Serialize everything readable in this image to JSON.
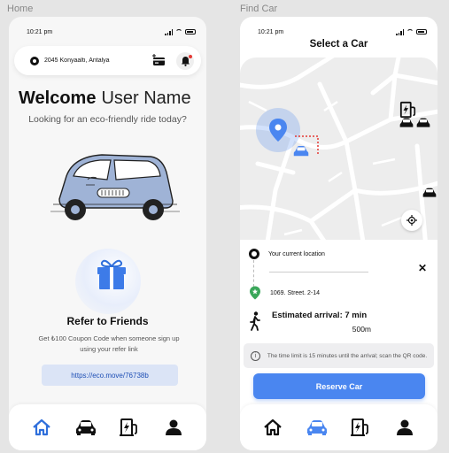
{
  "frames": {
    "home_label": "Home",
    "find_label": "Find Car"
  },
  "status": {
    "time": "10:21 pm"
  },
  "home": {
    "address": "2045 Konyaaltı, Antalya",
    "welcome_bold": "Welcome",
    "welcome_name": "User Name",
    "subtitle": "Looking for an eco-friendly ride today?",
    "refer_title": "Refer to Friends",
    "refer_subtitle": "Get ₺100 Coupon Code when someone sign up using your refer link",
    "refer_link": "https://eco.move/76738b"
  },
  "find": {
    "title": "Select a Car",
    "current_location": "Your current location",
    "destination": "1069. Street. 2-14",
    "eta": "Estimated arrival: 7 min",
    "distance": "500m",
    "info": "The time limit is 15 minutes until the arrival; scan the QR code.",
    "reserve_label": "Reserve Car"
  },
  "tabs": [
    "home-icon",
    "car-icon",
    "charging-station-icon",
    "user-icon"
  ],
  "colors": {
    "accent": "#4a86f0",
    "home_active_tab": "#2f6fdb",
    "car_body": "#9fb3d6",
    "green_pin": "#3aa75a",
    "notification_dot": "#e53935"
  }
}
